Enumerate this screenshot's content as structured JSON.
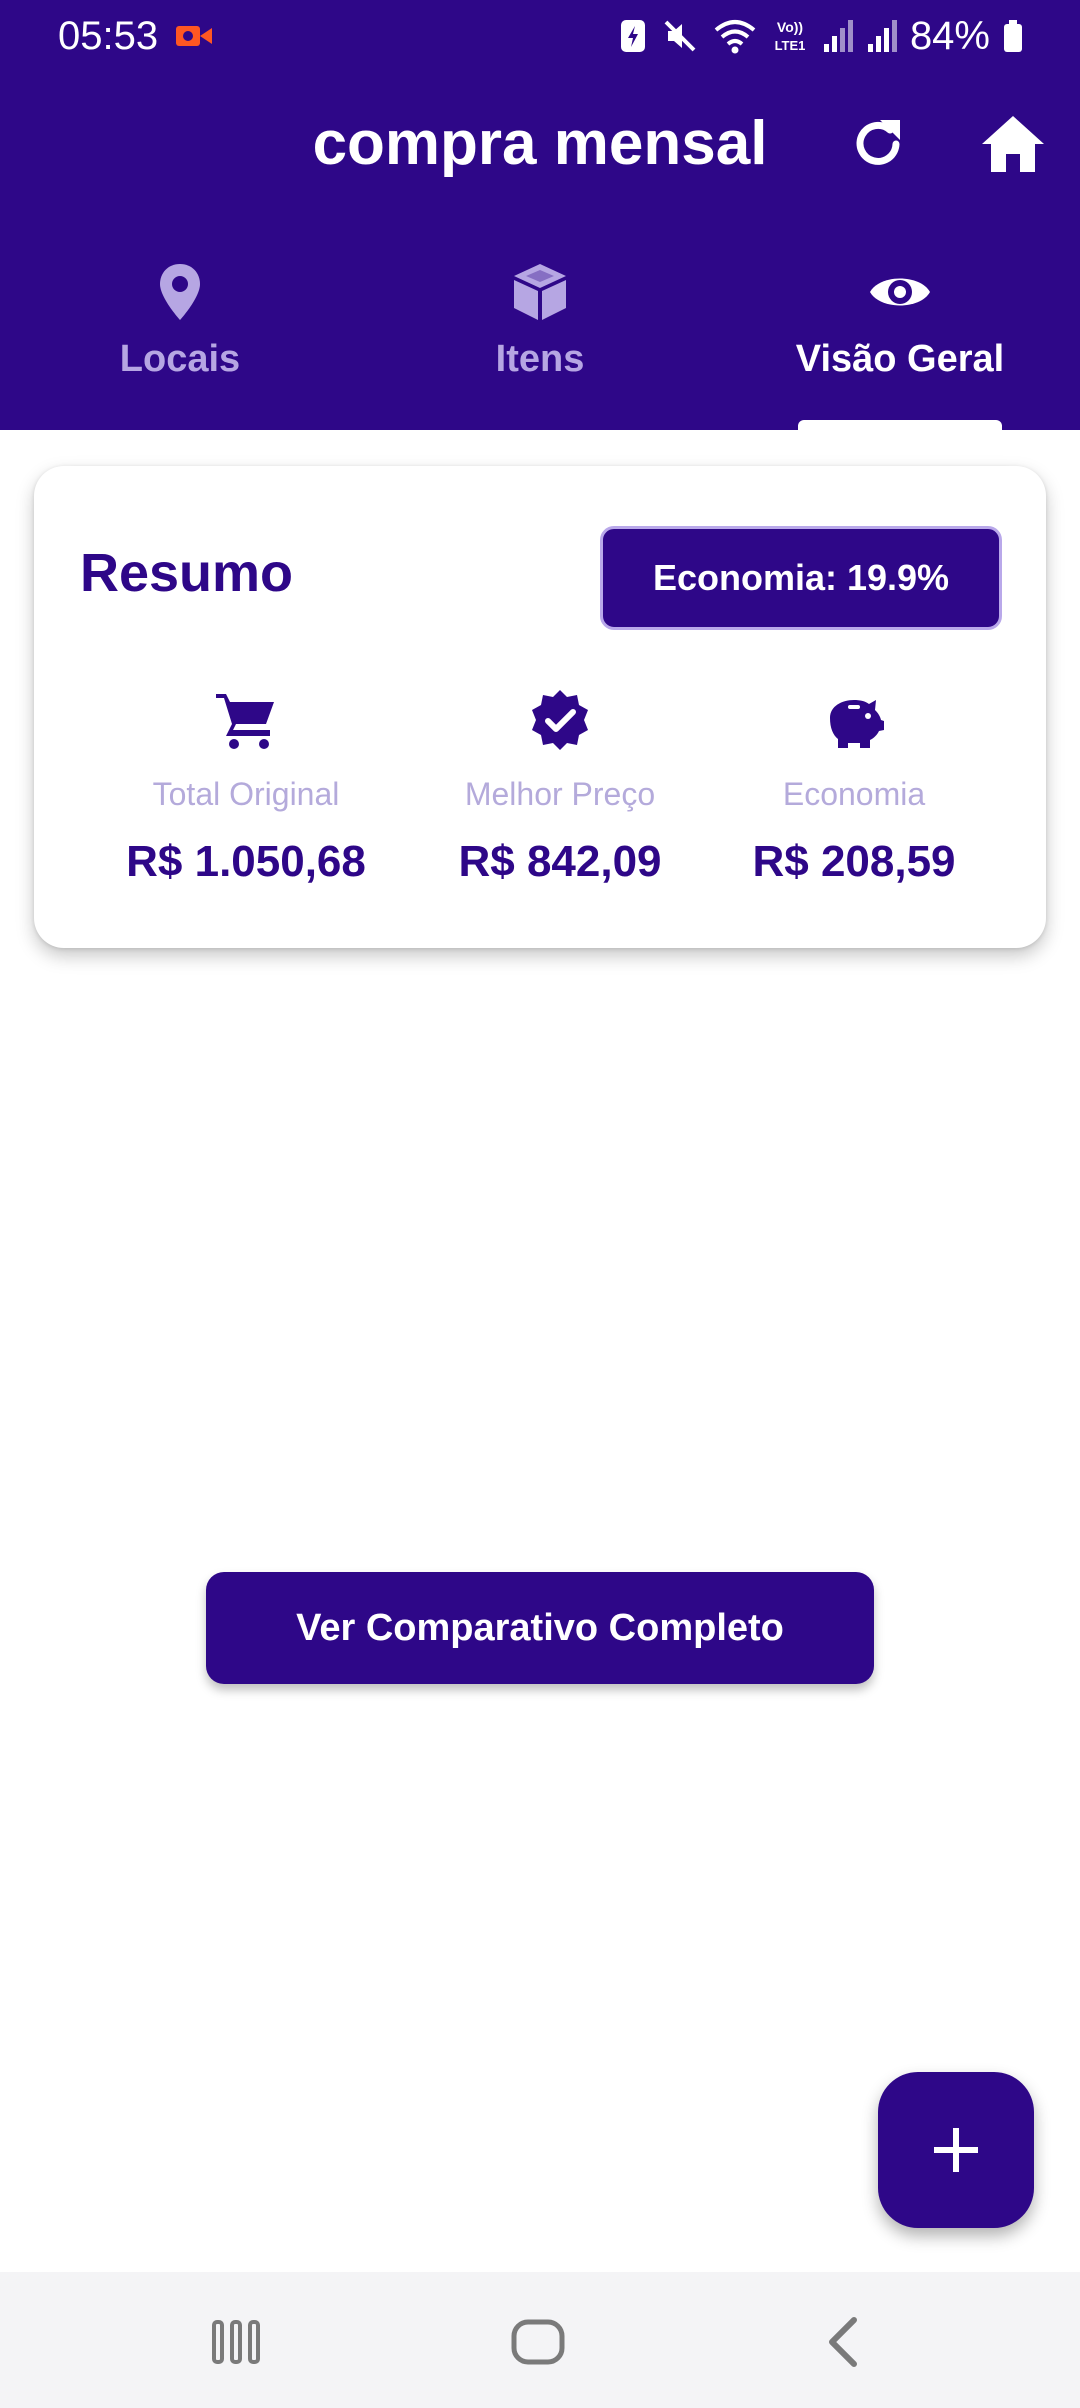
{
  "status_bar": {
    "time": "05:53",
    "battery": "84%",
    "icons": [
      "screen-record-icon",
      "data-saver-icon",
      "mute-icon",
      "wifi-icon",
      "volte-icon",
      "signal-icon",
      "signal-icon",
      "battery-icon"
    ]
  },
  "app_bar": {
    "title": "compra mensal",
    "actions": [
      "refresh-icon",
      "home-icon"
    ]
  },
  "tabs": [
    {
      "label": "Locais",
      "icon": "map-pin-icon",
      "active": false
    },
    {
      "label": "Itens",
      "icon": "box-icon",
      "active": false
    },
    {
      "label": "Visão Geral",
      "icon": "eye-icon",
      "active": true
    }
  ],
  "summary": {
    "title": "Resumo",
    "savings_badge": "Economia: 19.9%",
    "stats": [
      {
        "icon": "cart-icon",
        "label": "Total Original",
        "value": "R$ 1.050,68"
      },
      {
        "icon": "verified-badge-icon",
        "label": "Melhor Preço",
        "value": "R$ 842,09"
      },
      {
        "icon": "piggy-bank-icon",
        "label": "Economia",
        "value": "R$ 208,59"
      }
    ]
  },
  "compare_button": {
    "label": "Ver Comparativo Completo"
  },
  "fab": {
    "icon": "plus-icon"
  },
  "nav_bar": {
    "buttons": [
      "recents-icon",
      "home-icon",
      "back-icon"
    ]
  },
  "colors": {
    "primary": "#2e0788",
    "tab_inactive": "#b6a6e3",
    "stat_label": "#b4aadb",
    "background": "#ffffff",
    "nav_bar": "#f4f4f6",
    "recording": "#ff5722"
  }
}
